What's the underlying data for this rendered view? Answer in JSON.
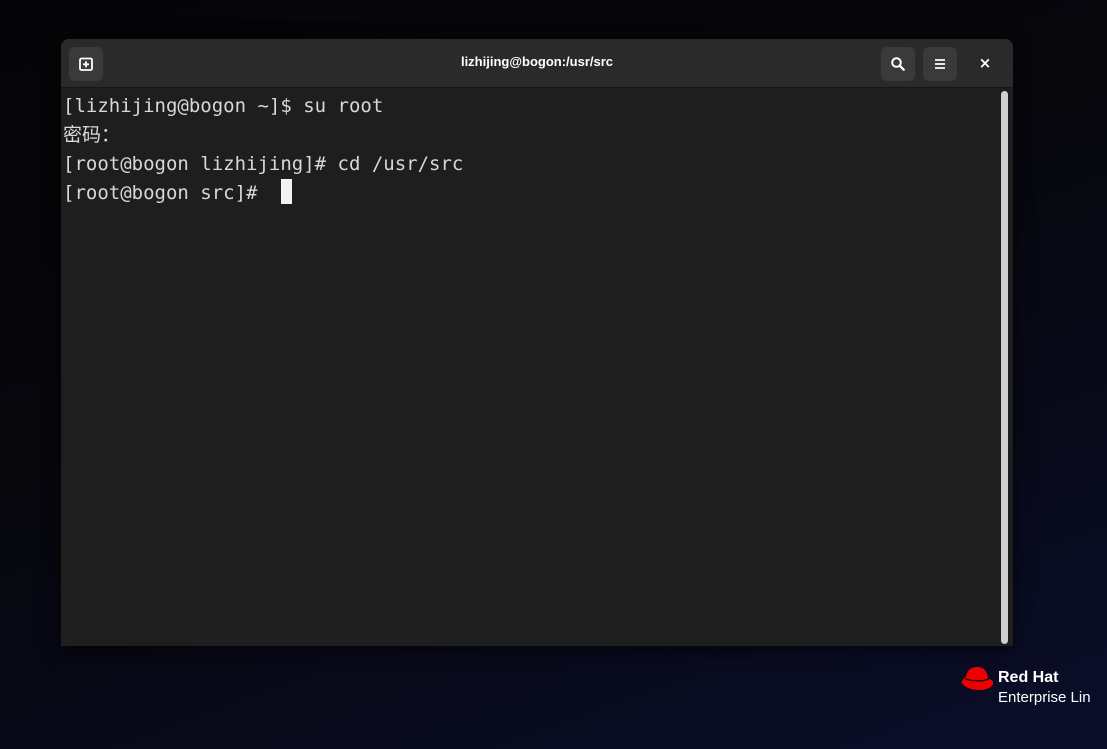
{
  "window": {
    "title": "lizhijing@bogon:/usr/src"
  },
  "titlebar": {
    "new_tab_icon": "new-tab-icon",
    "search_icon": "search-icon",
    "menu_icon": "hamburger-menu-icon",
    "close_label": "×"
  },
  "terminal": {
    "lines": [
      "[lizhijing@bogon ~]$ su root",
      "密码：",
      "[root@bogon lizhijing]# cd /usr/src",
      "[root@bogon src]# "
    ],
    "text_color": "#d8d8d8",
    "background": "#1e1e1e"
  },
  "branding": {
    "name": "Red Hat",
    "product": "Enterprise Lin",
    "accent": "#ee0000"
  }
}
